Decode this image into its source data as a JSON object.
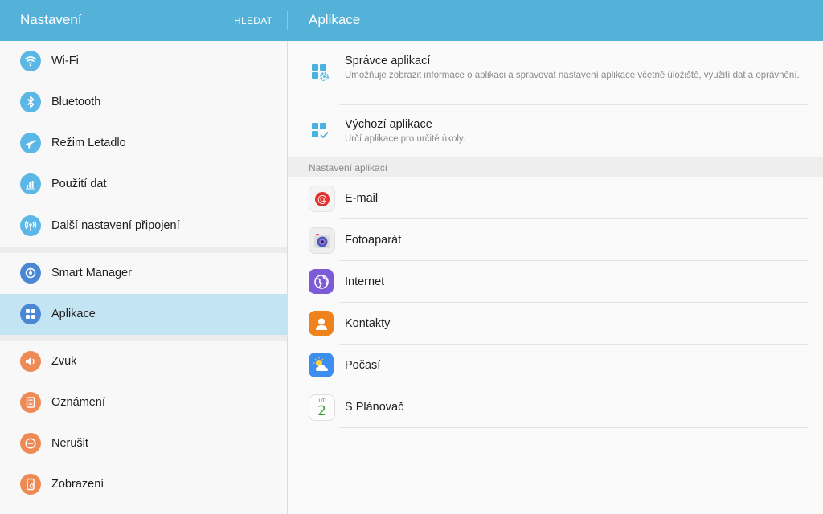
{
  "header": {
    "title": "Nastavení",
    "search_label": "HLEDAT",
    "right_title": "Aplikace"
  },
  "sidebar": {
    "items": [
      {
        "label": "Wi-Fi",
        "icon": "wifi-icon",
        "color": "#5ab7e6"
      },
      {
        "label": "Bluetooth",
        "icon": "bluetooth-icon",
        "color": "#5ab7e6"
      },
      {
        "label": "Režim Letadlo",
        "icon": "airplane-icon",
        "color": "#5ab7e6"
      },
      {
        "label": "Použití dat",
        "icon": "data-usage-icon",
        "color": "#5ab7e6"
      },
      {
        "label": "Další nastavení připojení",
        "icon": "connections-icon",
        "color": "#5ab7e6"
      },
      {
        "label": "Smart Manager",
        "icon": "smart-manager-icon",
        "color": "#4a88d6"
      },
      {
        "label": "Aplikace",
        "icon": "apps-icon",
        "color": "#4a88d6",
        "selected": true
      },
      {
        "label": "Zvuk",
        "icon": "sound-icon",
        "color": "#ee8a55"
      },
      {
        "label": "Oznámení",
        "icon": "notifications-icon",
        "color": "#ee8a55"
      },
      {
        "label": "Nerušit",
        "icon": "do-not-disturb-icon",
        "color": "#ee8a55"
      },
      {
        "label": "Zobrazení",
        "icon": "display-icon",
        "color": "#ee8a55"
      }
    ]
  },
  "main": {
    "top_items": [
      {
        "title": "Správce aplikací",
        "desc": "Umožňuje zobrazit informace o aplikaci a spravovat nastavení aplikace včetně úložiště, využití dat a oprávnění.",
        "icon": "app-manager-icon"
      },
      {
        "title": "Výchozí aplikace",
        "desc": "Určí aplikace pro určité úkoly.",
        "icon": "default-apps-icon"
      }
    ],
    "section_header": "Nastavení aplikací",
    "apps": [
      {
        "label": "E-mail",
        "icon": "email-icon"
      },
      {
        "label": "Fotoaparát",
        "icon": "camera-icon"
      },
      {
        "label": "Internet",
        "icon": "internet-icon"
      },
      {
        "label": "Kontakty",
        "icon": "contacts-icon"
      },
      {
        "label": "Počasí",
        "icon": "weather-icon"
      },
      {
        "label": "S Plánovač",
        "icon": "calendar-icon"
      }
    ],
    "calendar_icon_text": {
      "day": "ÚT",
      "date": "2"
    }
  },
  "colors": {
    "header_bg": "#54b1d8",
    "selected_bg": "#c3e4f2",
    "accent_blue": "#5ab7e6"
  }
}
